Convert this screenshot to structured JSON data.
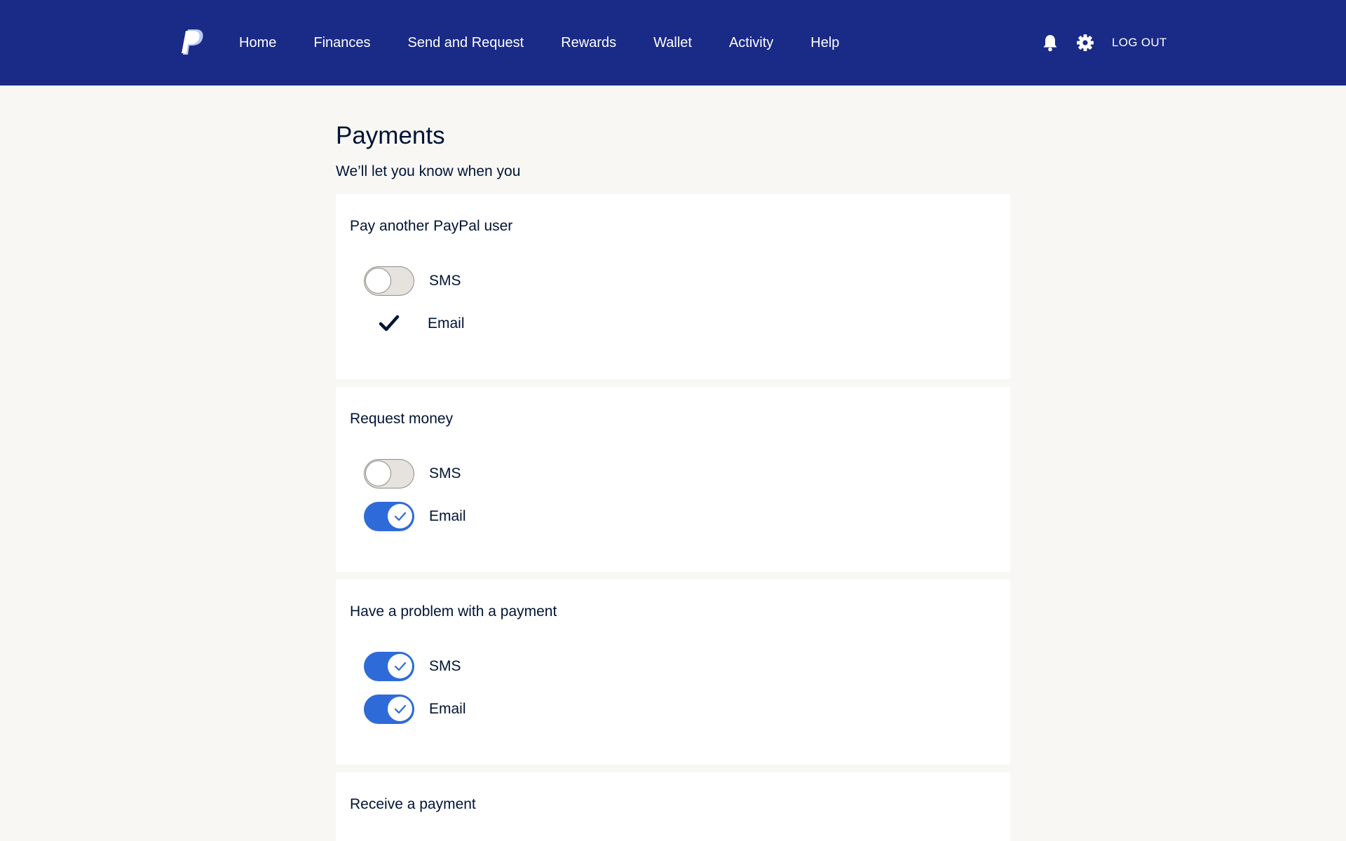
{
  "nav": {
    "links": [
      "Home",
      "Finances",
      "Send and Request",
      "Rewards",
      "Wallet",
      "Activity",
      "Help"
    ],
    "logout": "LOG OUT",
    "icons": {
      "logo": "paypal-logo",
      "notifications": "bell-icon",
      "settings": "gear-icon"
    },
    "colors": {
      "nav_bg": "#1a2a87",
      "page_bg": "#f8f7f4",
      "accent": "#2e6bd8"
    }
  },
  "page": {
    "title": "Payments",
    "subtitle": "We’ll let you know when you"
  },
  "sections": [
    {
      "title": "Pay another PayPal user",
      "options": [
        {
          "label": "SMS",
          "state": "off"
        },
        {
          "label": "Email",
          "state": "checked-locked"
        }
      ]
    },
    {
      "title": "Request money",
      "options": [
        {
          "label": "SMS",
          "state": "off"
        },
        {
          "label": "Email",
          "state": "on"
        }
      ]
    },
    {
      "title": "Have a problem with a payment",
      "options": [
        {
          "label": "SMS",
          "state": "on"
        },
        {
          "label": "Email",
          "state": "on"
        }
      ]
    },
    {
      "title": "Receive a payment",
      "options": []
    }
  ]
}
